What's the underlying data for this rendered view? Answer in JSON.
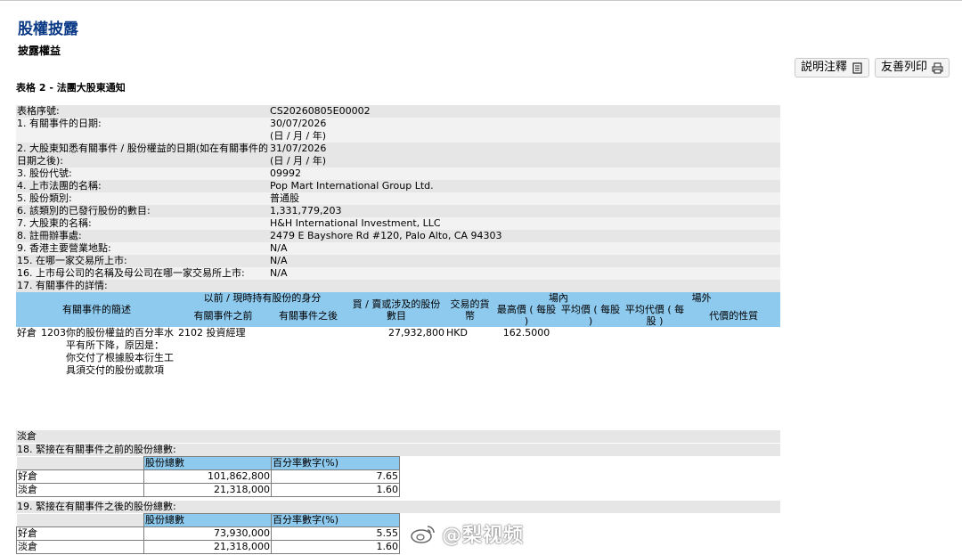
{
  "page": {
    "title": "股權披露",
    "subtitle": "披露權益",
    "section": "表格 2 - 法團大股東通知"
  },
  "toolbar": {
    "notes_label": "説明注釋",
    "print_label": "友善列印"
  },
  "fields": [
    {
      "label": "表格序號:",
      "value": "CS20260805E00002"
    },
    {
      "label": "1. 有關事件的日期:",
      "value": "30/07/2026",
      "note": "(日 / 月 / 年)"
    },
    {
      "label": "2. 大股東知悉有關事件 / 股份權益的日期(如在有關事件的日期之後):",
      "value": "31/07/2026",
      "note": "(日 / 月 / 年)"
    },
    {
      "label": "3. 股份代號:",
      "value": "09992"
    },
    {
      "label": "4. 上市法團的名稱:",
      "value": "Pop Mart International Group Ltd."
    },
    {
      "label": "5. 股份類別:",
      "value": "普通股"
    },
    {
      "label": "6. 該類別的已發行股份的數目:",
      "value": "1,331,779,203"
    },
    {
      "label": "7. 大股東的名稱:",
      "value": "H&H International Investment, LLC"
    },
    {
      "label": "8. 註冊辦事處:",
      "value": "2479 E Bayshore Rd #120, Palo Alto, CA 94303"
    },
    {
      "label": "9. 香港主要營業地點:",
      "value": "N/A"
    },
    {
      "label": "15. 在哪一家交易所上市:",
      "value": "N/A"
    },
    {
      "label": "16. 上市母公司的名稱及母公司在哪一家交易所上市:",
      "value": "N/A"
    },
    {
      "label": "17. 有關事件的詳情:",
      "value": ""
    }
  ],
  "event_table": {
    "headers": {
      "desc": "有關事件的簡述",
      "capacity_group": "以前 / 現時持有股份的身分",
      "before": "有關事件之前",
      "after": "有關事件之後",
      "shares": "買 / 賣或涉及的股份數目",
      "currency": "交易的貨幣",
      "onex": "場內",
      "offex": "場外",
      "highest": "最高價 ( 每股 )",
      "average": "平均價 ( 每股 )",
      "avg_consideration": "平均代價 ( 每股 )",
      "nature": "代價的性質"
    },
    "row": {
      "position": "好倉",
      "code": "1203",
      "desc": "你的股份權益的百分率水平有所下降，原因是：",
      "desc2": "你交付了根據股本衍生工具須交付的股份或款項",
      "cap_code": "2102",
      "capacity": "投資經理",
      "shares": "27,932,800",
      "currency": "HKD",
      "highest": "162.5000"
    },
    "short_label": "淡倉"
  },
  "before_totals": {
    "label": "18. 緊接在有關事件之前的股份總數:",
    "col_shares": "股份總數",
    "col_percent": "百分率數字(%)",
    "rows": [
      {
        "position": "好倉",
        "shares": "101,862,800",
        "percent": "7.65"
      },
      {
        "position": "淡倉",
        "shares": "21,318,000",
        "percent": "1.60"
      }
    ]
  },
  "after_totals": {
    "label": "19. 緊接在有關事件之後的股份總數:",
    "col_shares": "股份總數",
    "col_percent": "百分率數字(%)",
    "rows": [
      {
        "position": "好倉",
        "shares": "73,930,000",
        "percent": "5.55"
      },
      {
        "position": "淡倉",
        "shares": "21,318,000",
        "percent": "1.60"
      }
    ]
  },
  "watermark": {
    "text": "@梨视频",
    "icon": "weibo-logo-icon"
  },
  "colors": {
    "title": "#0b3a86",
    "header_blue": "#8ec9ee",
    "row_gray": "#e6e6e6"
  }
}
